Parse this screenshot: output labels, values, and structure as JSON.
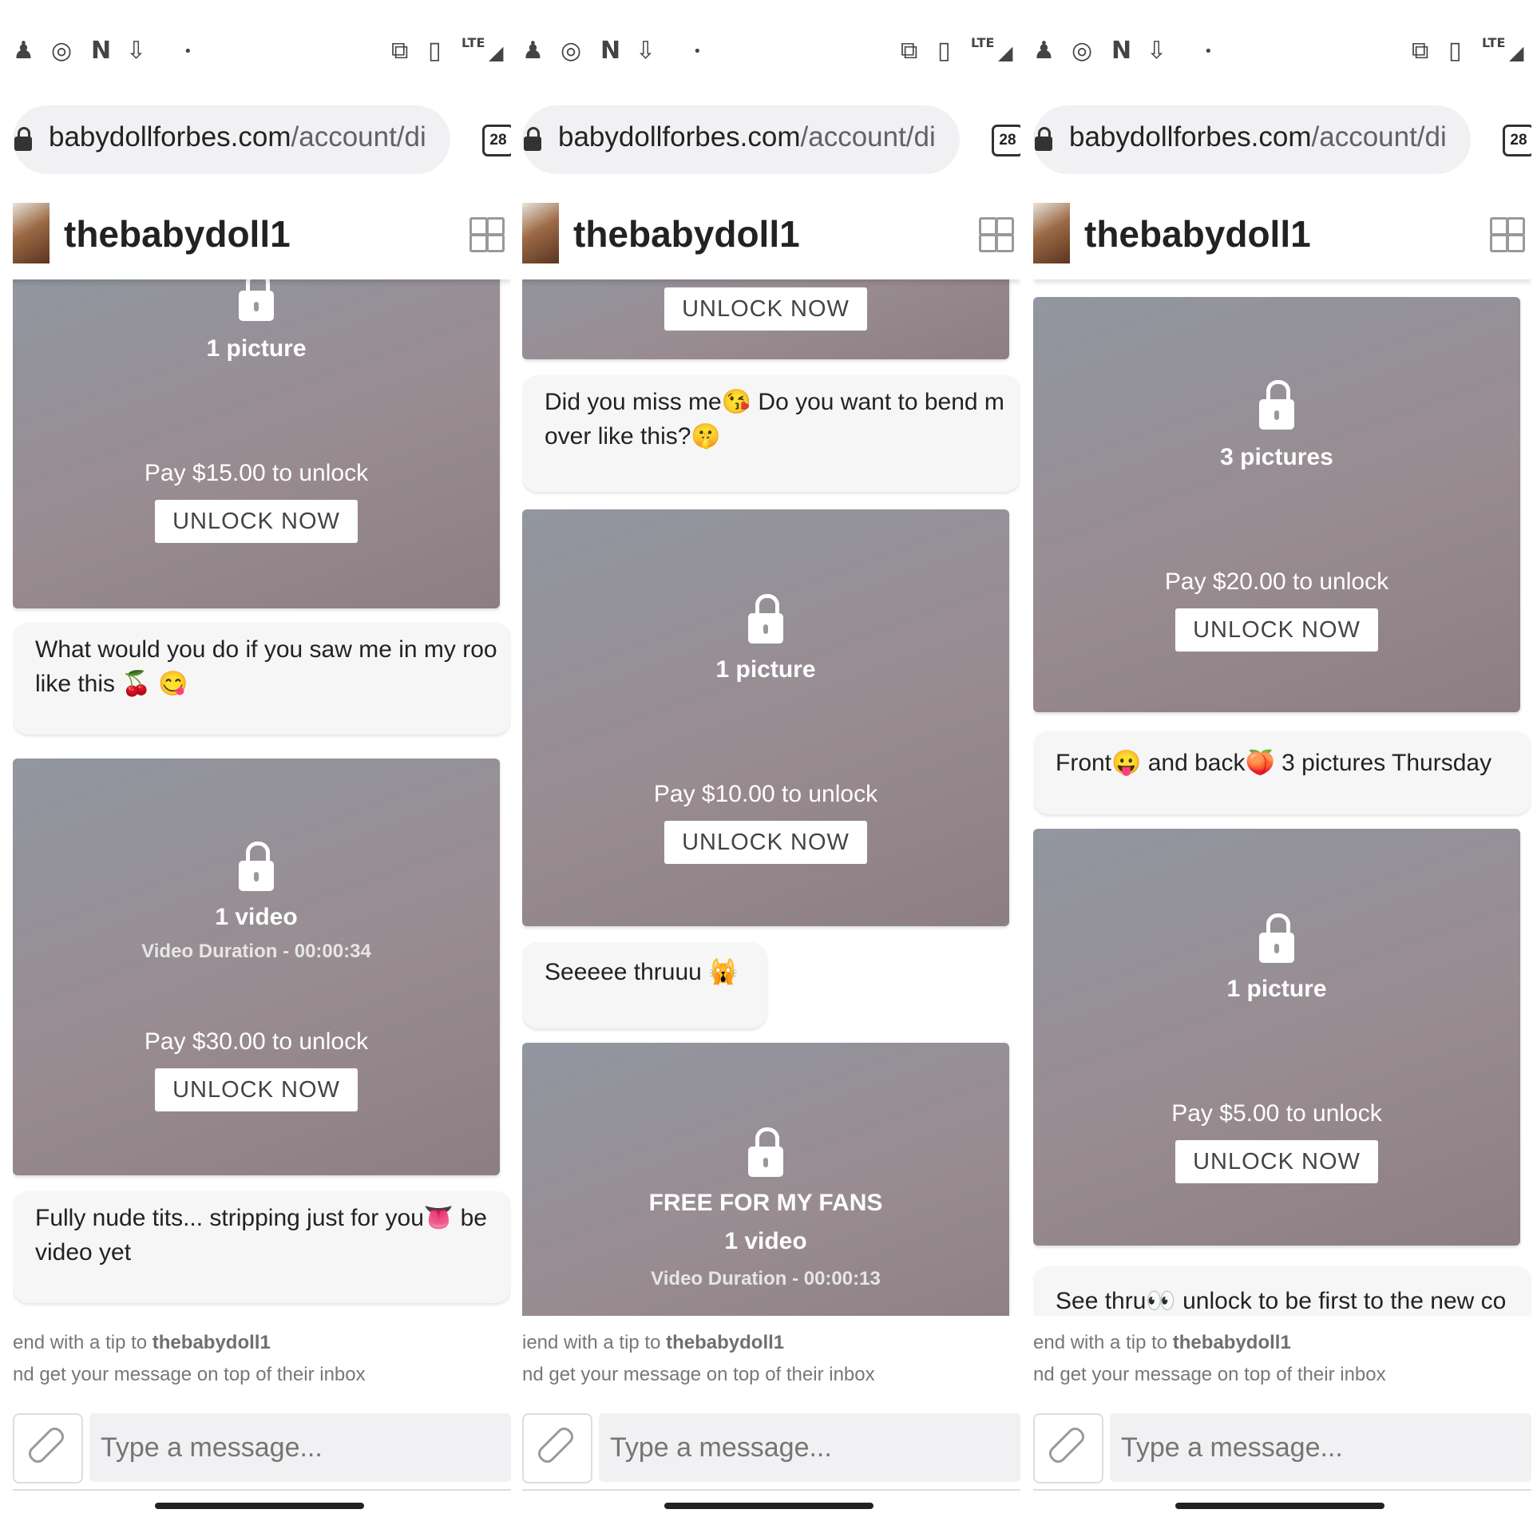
{
  "status_bar": {
    "left_icons": [
      "snapchat-icon",
      "instagram-icon",
      "netflix-icon",
      "download-icon",
      "dot-icon"
    ],
    "right_icons": [
      "cast-icon",
      "vibrate-icon",
      "lte-signal-icon"
    ],
    "lte_label": "LTE",
    "glyphs": {
      "snap": "♟",
      "insta": "◎",
      "netflix": "N",
      "download": "⇩",
      "dot": "•",
      "cast": "⧉",
      "vibrate": "▯",
      "signal": "◢"
    }
  },
  "browser": {
    "url_domain": "babydollforbes.com",
    "url_path": "/account/di",
    "tab_count": "28"
  },
  "chat": {
    "username": "thebabydoll1",
    "tip_prefix": "end with a tip to ",
    "tip_prefix_mid": "iend with a tip to ",
    "tip_line2": "nd get your message on top of their inbox",
    "input_placeholder": "Type a message..."
  },
  "panels": [
    {
      "locked": [
        {
          "type": "1 picture",
          "price": "Pay $15.00 to unlock",
          "button": "UNLOCK NOW"
        },
        {
          "type": "1 video",
          "duration": "Video Duration - 00:00:34",
          "price": "Pay $30.00 to unlock",
          "button": "UNLOCK NOW"
        }
      ],
      "messages": [
        {
          "line1": "What would you do if you saw me in my roo",
          "line2": "like this  🍒 😋"
        },
        {
          "line1": "Fully nude tits... stripping just for you👅 be",
          "line2": "video yet"
        }
      ]
    },
    {
      "locked": [
        {
          "button": "UNLOCK NOW"
        },
        {
          "type": "1 picture",
          "price": "Pay $10.00 to unlock",
          "button": "UNLOCK NOW"
        },
        {
          "label": "FREE FOR MY FANS",
          "type": "1 video",
          "duration": "Video Duration - 00:00:13"
        }
      ],
      "messages": [
        {
          "line1": "Did you miss me😘 Do you want to bend m",
          "line2": "over like this?🤫"
        },
        {
          "line1": "Seeeee thruuu 🙀"
        }
      ]
    },
    {
      "locked": [
        {
          "type": "3 pictures",
          "price": "Pay $20.00 to unlock",
          "button": "UNLOCK NOW"
        },
        {
          "type": "1 picture",
          "price": "Pay $5.00 to unlock",
          "button": "UNLOCK NOW"
        }
      ],
      "messages": [
        {
          "line1": "Front😛 and back🍑 3 pictures Thursday"
        },
        {
          "line1": "See thru👀 unlock to be first to the new co"
        }
      ]
    }
  ]
}
